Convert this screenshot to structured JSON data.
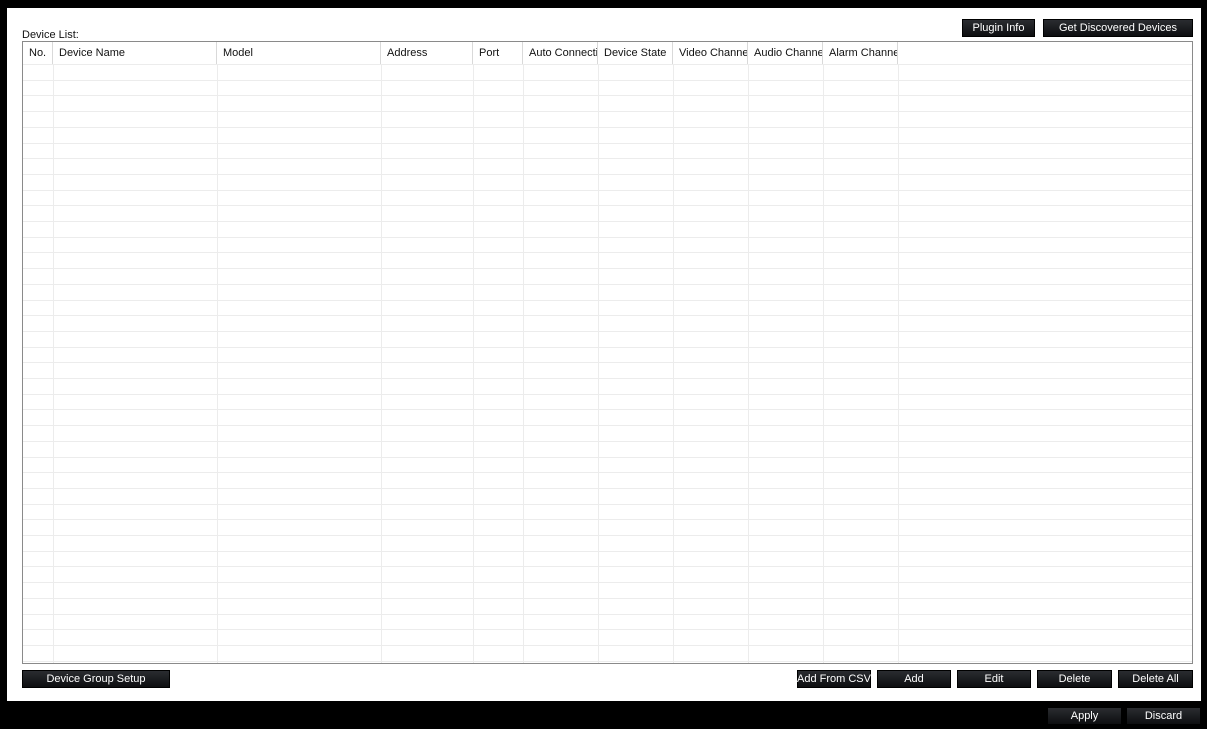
{
  "device_list": {
    "label": "Device List:",
    "columns": [
      "No.",
      "Device Name",
      "Model",
      "Address",
      "Port",
      "Auto Connecti...",
      "Device State",
      "Video Channel",
      "Audio Channel",
      "Alarm Channel"
    ],
    "rows": []
  },
  "top_buttons": {
    "plugin_info": "Plugin Info",
    "get_discovered": "Get Discovered Devices"
  },
  "bottom_buttons": {
    "device_group_setup": "Device Group Setup",
    "add_from_csv": "Add From CSV",
    "add": "Add",
    "edit": "Edit",
    "delete": "Delete",
    "delete_all": "Delete All"
  },
  "footer_buttons": {
    "apply": "Apply",
    "discard": "Discard"
  }
}
